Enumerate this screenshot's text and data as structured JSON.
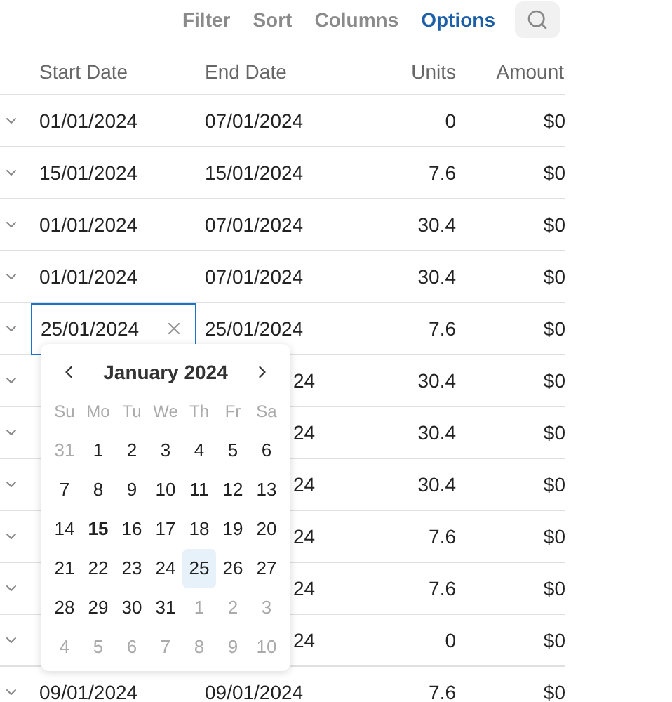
{
  "toolbar": [
    {
      "label": "Filter",
      "selected": false
    },
    {
      "label": "Sort",
      "selected": false
    },
    {
      "label": "Columns",
      "selected": false
    },
    {
      "label": "Options",
      "selected": true
    }
  ],
  "columns": [
    "Start Date",
    "End Date",
    "Units",
    "Amount"
  ],
  "rows": [
    {
      "start_date": "01/01/2024",
      "end_date": "07/01/2024",
      "units": "0",
      "amount": "$0"
    },
    {
      "start_date": "15/01/2024",
      "end_date": "15/01/2024",
      "units": "7.6",
      "amount": "$0"
    },
    {
      "start_date": "01/01/2024",
      "end_date": "07/01/2024",
      "units": "30.4",
      "amount": "$0"
    },
    {
      "start_date": "01/01/2024",
      "end_date": "07/01/2024",
      "units": "30.4",
      "amount": "$0"
    },
    {
      "kind": "editing",
      "start_date": "25/01/2024",
      "end_date": "25/01/2024",
      "units": "7.6",
      "amount": "$0"
    },
    {
      "kind": "covered",
      "end_date": "24",
      "units": "30.4",
      "amount": "$0"
    },
    {
      "kind": "covered",
      "end_date": "24",
      "units": "30.4",
      "amount": "$0"
    },
    {
      "kind": "covered",
      "end_date": "24",
      "units": "30.4",
      "amount": "$0"
    },
    {
      "kind": "covered",
      "end_date": "24",
      "units": "7.6",
      "amount": "$0"
    },
    {
      "kind": "covered",
      "end_date": "24",
      "units": "7.6",
      "amount": "$0"
    },
    {
      "kind": "covered",
      "end_date": "24",
      "units": "0",
      "amount": "$0"
    },
    {
      "start_date": "09/01/2024",
      "end_date": "09/01/2024",
      "units": "7.6",
      "amount": "$0"
    }
  ],
  "calendar": {
    "title": "January 2024",
    "weekdays": [
      "Su",
      "Mo",
      "Tu",
      "We",
      "Th",
      "Fr",
      "Sa"
    ],
    "days": [
      {
        "label": "31",
        "outside": true,
        "bold": false,
        "selected": false
      },
      {
        "label": "1",
        "outside": false,
        "bold": false,
        "selected": false
      },
      {
        "label": "2",
        "outside": false,
        "bold": false,
        "selected": false
      },
      {
        "label": "3",
        "outside": false,
        "bold": false,
        "selected": false
      },
      {
        "label": "4",
        "outside": false,
        "bold": false,
        "selected": false
      },
      {
        "label": "5",
        "outside": false,
        "bold": false,
        "selected": false
      },
      {
        "label": "6",
        "outside": false,
        "bold": false,
        "selected": false
      },
      {
        "label": "7",
        "outside": false,
        "bold": false,
        "selected": false
      },
      {
        "label": "8",
        "outside": false,
        "bold": false,
        "selected": false
      },
      {
        "label": "9",
        "outside": false,
        "bold": false,
        "selected": false
      },
      {
        "label": "10",
        "outside": false,
        "bold": false,
        "selected": false
      },
      {
        "label": "11",
        "outside": false,
        "bold": false,
        "selected": false
      },
      {
        "label": "12",
        "outside": false,
        "bold": false,
        "selected": false
      },
      {
        "label": "13",
        "outside": false,
        "bold": false,
        "selected": false
      },
      {
        "label": "14",
        "outside": false,
        "bold": false,
        "selected": false
      },
      {
        "label": "15",
        "outside": false,
        "bold": true,
        "selected": false
      },
      {
        "label": "16",
        "outside": false,
        "bold": false,
        "selected": false
      },
      {
        "label": "17",
        "outside": false,
        "bold": false,
        "selected": false
      },
      {
        "label": "18",
        "outside": false,
        "bold": false,
        "selected": false
      },
      {
        "label": "19",
        "outside": false,
        "bold": false,
        "selected": false
      },
      {
        "label": "20",
        "outside": false,
        "bold": false,
        "selected": false
      },
      {
        "label": "21",
        "outside": false,
        "bold": false,
        "selected": false
      },
      {
        "label": "22",
        "outside": false,
        "bold": false,
        "selected": false
      },
      {
        "label": "23",
        "outside": false,
        "bold": false,
        "selected": false
      },
      {
        "label": "24",
        "outside": false,
        "bold": false,
        "selected": false
      },
      {
        "label": "25",
        "outside": false,
        "bold": false,
        "selected": true
      },
      {
        "label": "26",
        "outside": false,
        "bold": false,
        "selected": false
      },
      {
        "label": "27",
        "outside": false,
        "bold": false,
        "selected": false
      },
      {
        "label": "28",
        "outside": false,
        "bold": false,
        "selected": false
      },
      {
        "label": "29",
        "outside": false,
        "bold": false,
        "selected": false
      },
      {
        "label": "30",
        "outside": false,
        "bold": false,
        "selected": false
      },
      {
        "label": "31",
        "outside": false,
        "bold": false,
        "selected": false
      },
      {
        "label": "1",
        "outside": true,
        "bold": false,
        "selected": false
      },
      {
        "label": "2",
        "outside": true,
        "bold": false,
        "selected": false
      },
      {
        "label": "3",
        "outside": true,
        "bold": false,
        "selected": false
      },
      {
        "label": "4",
        "outside": true,
        "bold": false,
        "selected": false
      },
      {
        "label": "5",
        "outside": true,
        "bold": false,
        "selected": false
      },
      {
        "label": "6",
        "outside": true,
        "bold": false,
        "selected": false
      },
      {
        "label": "7",
        "outside": true,
        "bold": false,
        "selected": false
      },
      {
        "label": "8",
        "outside": true,
        "bold": false,
        "selected": false
      },
      {
        "label": "9",
        "outside": true,
        "bold": false,
        "selected": false
      },
      {
        "label": "10",
        "outside": true,
        "bold": false,
        "selected": false
      }
    ]
  }
}
